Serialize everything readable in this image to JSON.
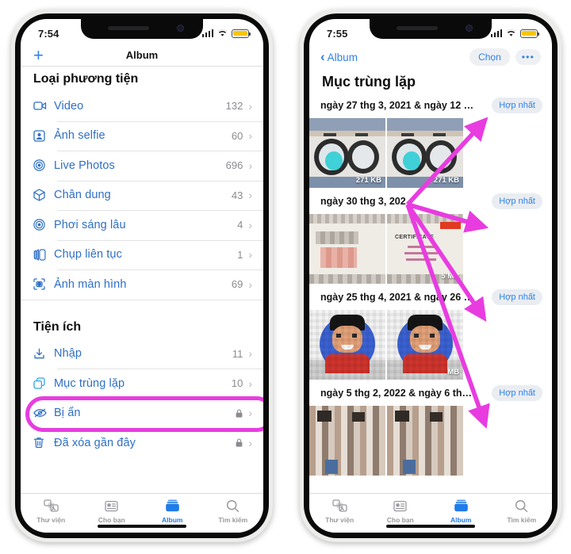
{
  "colors": {
    "accent_blue": "#2f82e8",
    "list_blue": "#2f6fc4",
    "highlight_magenta": "#e83ce0",
    "arrow_magenta": "#e83ce0",
    "battery_yellow": "#f7c600",
    "pill_bg": "#e9edf2"
  },
  "left_phone": {
    "status": {
      "time": "7:54",
      "signal_icon": "cellular-bars-icon",
      "wifi_icon": "wifi-icon",
      "battery_icon": "battery-icon"
    },
    "navbar": {
      "add_label": "+",
      "title": "Album"
    },
    "sections": [
      {
        "heading": "Loại phương tiện",
        "items": [
          {
            "icon": "video-camera-icon",
            "label": "Video",
            "count": "132",
            "locked": false
          },
          {
            "icon": "selfie-portrait-icon",
            "label": "Ảnh selfie",
            "count": "60",
            "locked": false
          },
          {
            "icon": "live-photos-icon",
            "label": "Live Photos",
            "count": "696",
            "locked": false
          },
          {
            "icon": "cube-portrait-icon",
            "label": "Chân dung",
            "count": "43",
            "locked": false
          },
          {
            "icon": "long-exposure-icon",
            "label": "Phơi sáng lâu",
            "count": "4",
            "locked": false
          },
          {
            "icon": "burst-photos-icon",
            "label": "Chụp liên tục",
            "count": "1",
            "locked": false
          },
          {
            "icon": "screenshot-icon",
            "label": "Ảnh màn hình",
            "count": "69",
            "locked": false
          }
        ]
      },
      {
        "heading": "Tiện ích",
        "items": [
          {
            "icon": "import-icon",
            "label": "Nhập",
            "count": "11",
            "locked": false
          },
          {
            "icon": "duplicates-icon",
            "label": "Mục trùng lặp",
            "count": "10",
            "locked": false,
            "highlighted": true
          },
          {
            "icon": "eye-slash-icon",
            "label": "Bị ẩn",
            "count": "",
            "locked": true
          },
          {
            "icon": "trash-icon",
            "label": "Đã xóa gần đây",
            "count": "",
            "locked": true
          }
        ]
      }
    ],
    "tabs": [
      {
        "icon": "library-icon",
        "label": "Thư viện",
        "active": false
      },
      {
        "icon": "foryou-icon",
        "label": "Cho bạn",
        "active": false
      },
      {
        "icon": "albums-icon",
        "label": "Album",
        "active": true
      },
      {
        "icon": "search-icon",
        "label": "Tìm kiếm",
        "active": false
      }
    ]
  },
  "right_phone": {
    "status": {
      "time": "7:55",
      "signal_icon": "cellular-bars-icon",
      "wifi_icon": "wifi-icon",
      "battery_icon": "battery-icon"
    },
    "navbar": {
      "back_label": "Album",
      "select_label": "Chọn",
      "more_label": "•••"
    },
    "title": "Mục trùng lặp",
    "groups": [
      {
        "date": "ngày 27 thg 3, 2021 & ngày 12 thg...",
        "merge_label": "Hợp nhất",
        "thumbs": [
          {
            "kind": "jewel",
            "size": "271 KB"
          },
          {
            "kind": "jewel",
            "size": "271 KB"
          }
        ]
      },
      {
        "date": "ngày 30 thg 3, 202",
        "merge_label": "Hợp nhất",
        "thumbs": [
          {
            "kind": "cert",
            "size": ""
          },
          {
            "kind": "cert",
            "size": "5 MB"
          }
        ]
      },
      {
        "date": "ngày 25 thg 4, 2021 & ngày 26 thg...",
        "merge_label": "Hợp nhất",
        "thumbs": [
          {
            "kind": "avatar",
            "size": ""
          },
          {
            "kind": "avatar",
            "size": "MB"
          }
        ]
      },
      {
        "date": "ngày 5 thg 2, 2022 & ngày 6 thg 3,...",
        "merge_label": "Hợp nhất",
        "thumbs": [
          {
            "kind": "crowd",
            "size": ""
          },
          {
            "kind": "crowd",
            "size": ""
          }
        ]
      }
    ],
    "tabs": [
      {
        "icon": "library-icon",
        "label": "Thư viện",
        "active": false
      },
      {
        "icon": "foryou-icon",
        "label": "Cho bạn",
        "active": false
      },
      {
        "icon": "albums-icon",
        "label": "Album",
        "active": true
      },
      {
        "icon": "search-icon",
        "label": "Tìm kiếm",
        "active": false
      }
    ]
  },
  "annotations": {
    "highlight_target": "Mục trùng lặp",
    "arrow_count": 4,
    "arrow_origin": "duplicate-thumbnail-area",
    "arrow_targets": [
      "Hợp nhất",
      "Hợp nhất",
      "Hợp nhất",
      "Hợp nhất"
    ]
  }
}
